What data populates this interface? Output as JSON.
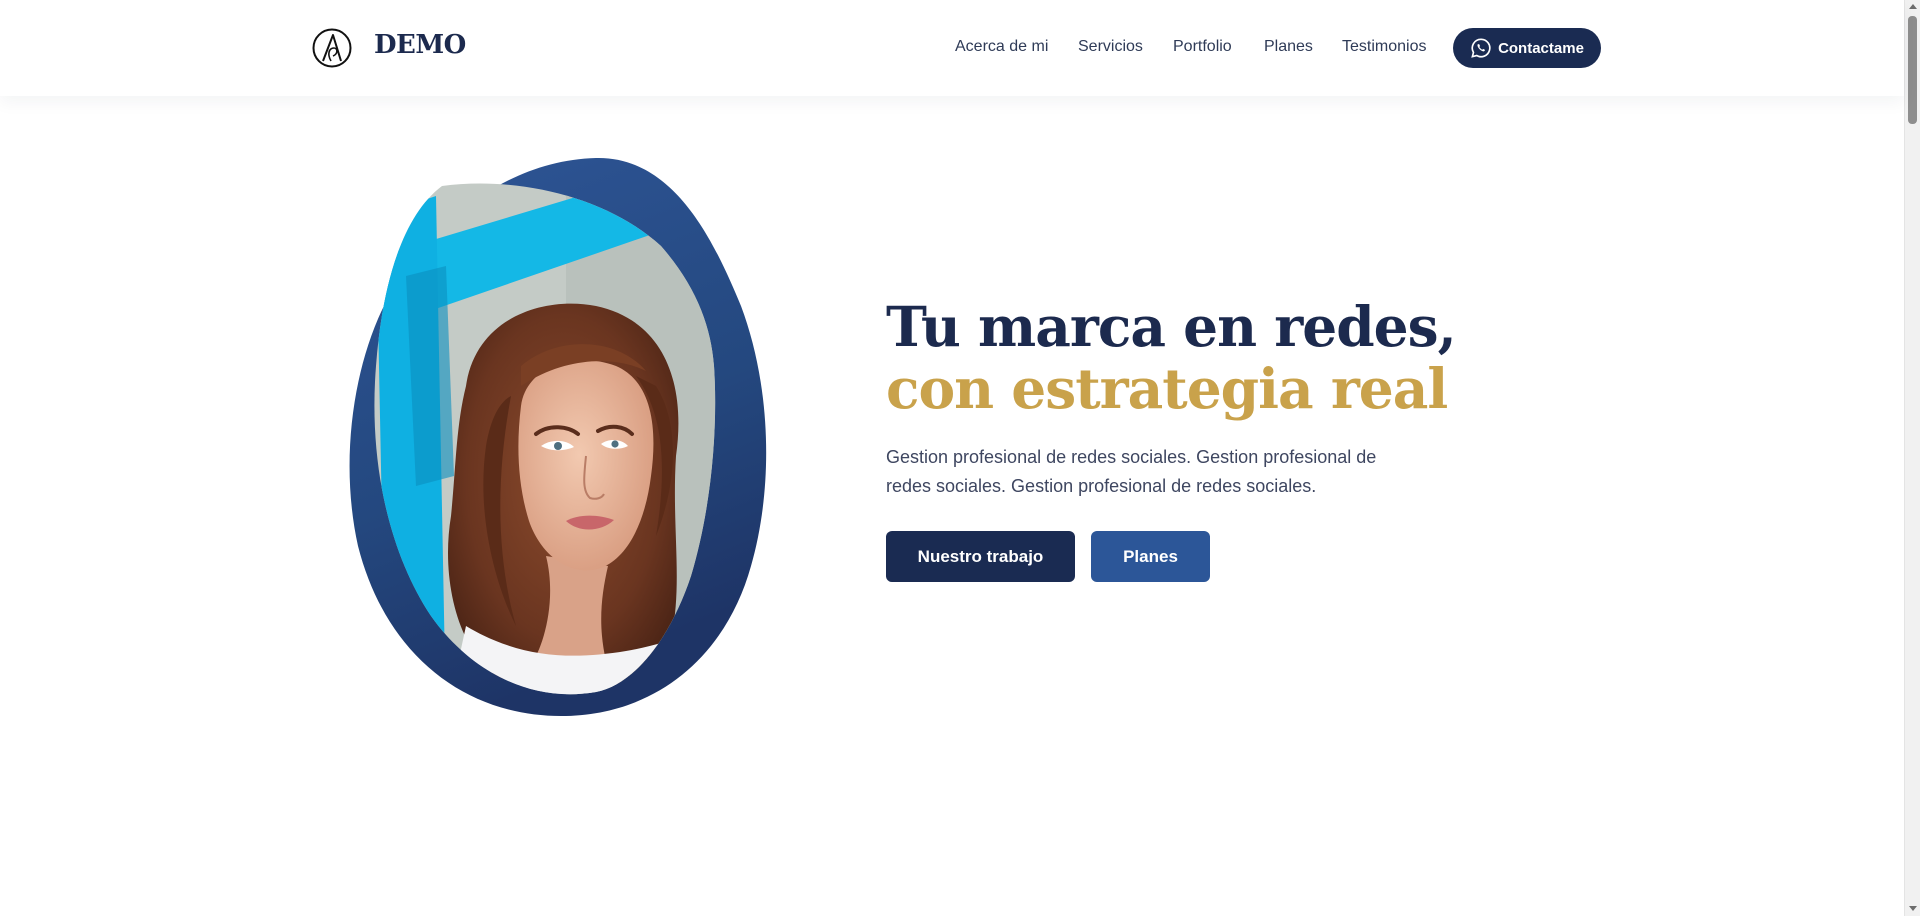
{
  "header": {
    "logo_text": "DEMO",
    "nav": [
      {
        "label": "Acerca de mi"
      },
      {
        "label": "Servicios"
      },
      {
        "label": "Portfolio"
      },
      {
        "label": "Planes"
      },
      {
        "label": "Testimonios"
      }
    ],
    "contact_label": "Contactame",
    "contact_icon": "whatsapp-icon"
  },
  "hero": {
    "headline_dark": "Tu marca en redes, ",
    "headline_accent": "con estrategia real",
    "lead": "Gestion profesional de redes sociales. Gestion profesional de redes sociales. Gestion profesional de redes sociales.",
    "primary_button": "Nuestro trabajo",
    "secondary_button": "Planes"
  },
  "colors": {
    "navy": "#1a2b52",
    "blue": "#2c5698",
    "gold": "#c9a24b",
    "text": "#3e4660"
  }
}
